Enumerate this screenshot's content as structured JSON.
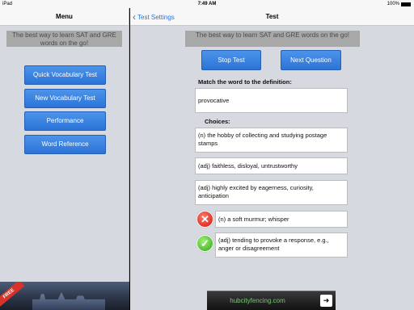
{
  "status_bar": {
    "carrier": "iPad",
    "time": "7:49 AM",
    "battery": "100%"
  },
  "menu": {
    "title": "Menu",
    "tagline": "The best way to learn SAT and GRE words on the go!",
    "buttons": [
      {
        "label": "Quick Vocabulary Test"
      },
      {
        "label": "New Vocabulary Test"
      },
      {
        "label": "Performance"
      },
      {
        "label": "Word Reference"
      }
    ]
  },
  "ad_left": {
    "badge": "FREE"
  },
  "main": {
    "back_label": "Test Settings",
    "title": "Test",
    "tagline": "The best way to learn SAT and GRE words on the go!",
    "stop_label": "Stop Test",
    "next_label": "Next Question",
    "prompt": "Match the word to the definition:",
    "word": "provocative",
    "choices_label": "Choices:",
    "choices": [
      {
        "text": "(n) the hobby of collecting and studying postage stamps"
      },
      {
        "text": "(adj) faithless, disloyal, untrustworthy"
      },
      {
        "text": "(adj) highly excited by eagerness, curiosity, anticipation"
      },
      {
        "text": "(n) a soft murmur; whisper",
        "mark": "wrong"
      },
      {
        "text": "(adj) tending to provoke a response, e.g., anger or disagreement",
        "mark": "correct"
      }
    ]
  },
  "ad_right": {
    "text": "hubcityfencing.com",
    "arrow": "➜"
  },
  "colors": {
    "button": "#2f7ae0",
    "pane_background": "#d6d9e0",
    "link": "#2a72dd",
    "wrong": "#d1140c",
    "correct": "#2fa80f"
  }
}
